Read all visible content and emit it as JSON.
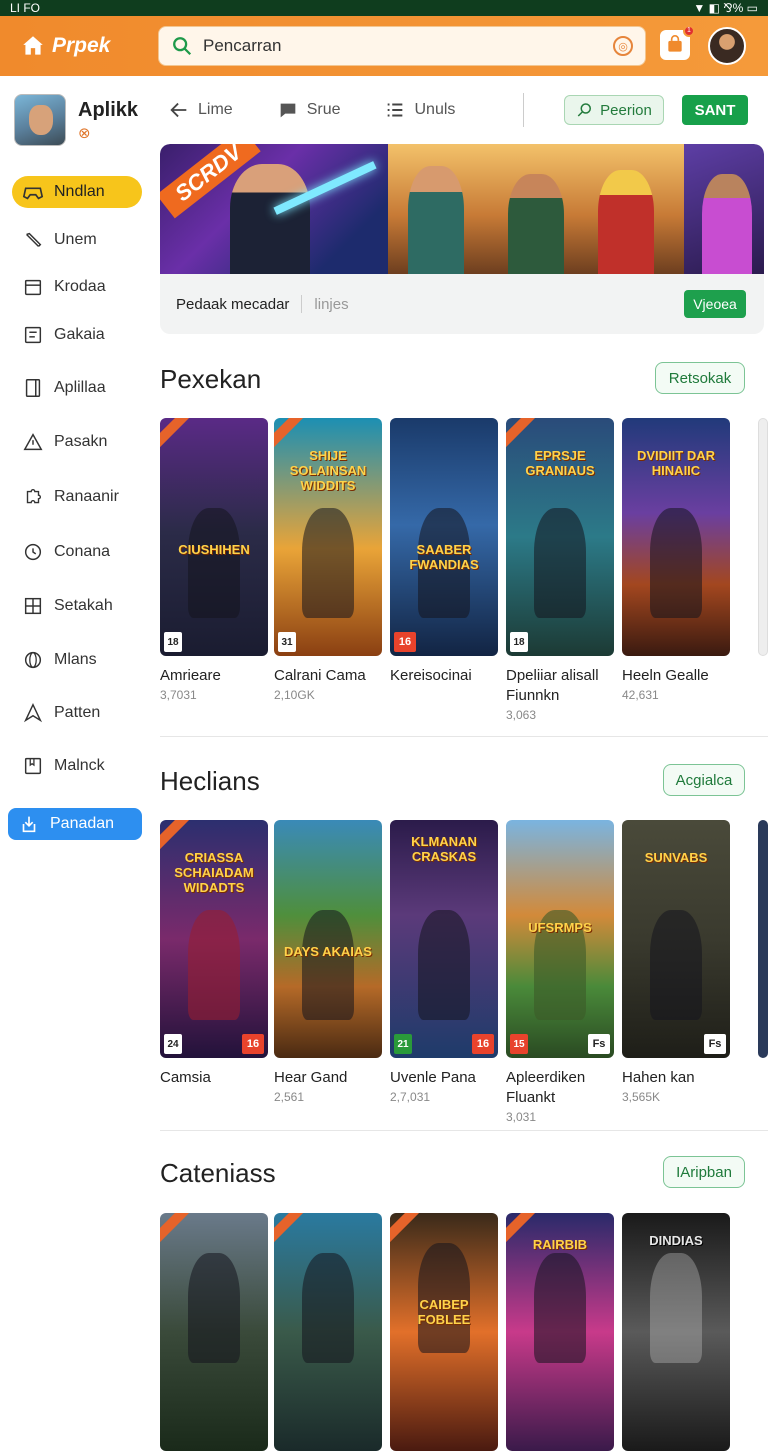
{
  "status": {
    "left": "LI FO",
    "right": "▼ ◧ ⅋% ▭"
  },
  "app": {
    "logo": "Prpek"
  },
  "search": {
    "placeholder": "Pencarran",
    "value": "Pencarran"
  },
  "header": {
    "notification_count": "1"
  },
  "sidebar": {
    "profile_name": "Aplikk",
    "items": [
      {
        "label": "Nndlan",
        "icon": "gamepad-icon"
      },
      {
        "label": "Unem",
        "icon": "pencil-icon"
      },
      {
        "label": "Krodaa",
        "icon": "calendar-icon"
      },
      {
        "label": "Gakaia",
        "icon": "clipboard-icon"
      },
      {
        "label": "Aplillaa",
        "icon": "tablet-icon"
      },
      {
        "label": "Pasakn",
        "icon": "warning-icon"
      },
      {
        "label": "Ranaanir",
        "icon": "puzzle-icon"
      },
      {
        "label": "Conana",
        "icon": "clock-icon"
      },
      {
        "label": "Setakah",
        "icon": "grid-icon"
      },
      {
        "label": "Mlans",
        "icon": "globe-icon"
      },
      {
        "label": "Patten",
        "icon": "location-icon"
      },
      {
        "label": "Malnck",
        "icon": "bookmark-icon"
      },
      {
        "label": "Panadan",
        "icon": "download-icon"
      }
    ]
  },
  "toolbar": {
    "back_label": "Lime",
    "store_label": "Srue",
    "list_label": "Unuls",
    "prec_label": "Peerion",
    "sant_label": "SANT"
  },
  "banner": {
    "tag": "SCRDV",
    "caption": "Pedaak mecadar",
    "sub": "linjes",
    "button": "Vjeoea"
  },
  "sections": [
    {
      "title": "Pexekan",
      "button": "Retsokak",
      "cards": [
        {
          "name": "Amrieare",
          "count": "3,7031",
          "art": "CIUSHIHEN",
          "rating": "18",
          "age": ""
        },
        {
          "name": "Calrani Cama",
          "count": "2,10GK",
          "art": "SHIJE SOLAINSAN WIDDITS",
          "rating": "31",
          "age": ""
        },
        {
          "name": "Kereisocinai",
          "count": "",
          "art": "SAABER FWANDIAS",
          "rating": "",
          "age": "16"
        },
        {
          "name": "Dpeliiar alisall Fiunnkn",
          "count": "3,063",
          "art": "EPRSJE GRANIAUS",
          "rating": "18",
          "age": ""
        },
        {
          "name": "Heeln Gealle",
          "count": "42,631",
          "art": "DVIDIIT DAR HINAIIC",
          "rating": "",
          "age": ""
        }
      ]
    },
    {
      "title": "Heclians",
      "button": "Acgialca",
      "cards": [
        {
          "name": "Camsia",
          "count": "",
          "art": "CRIASSA SCHAIADAM WIDADTS",
          "rating": "24",
          "age": "16"
        },
        {
          "name": "Hear Gand",
          "count": "2,561",
          "art": "DAYS AKAIAS",
          "rating": "",
          "age": ""
        },
        {
          "name": "Uvenle Pana",
          "count": "2,7,031",
          "art": "KLMANAN CRASKAS",
          "rating": "21",
          "age": "16"
        },
        {
          "name": "Apleerdiken Fluankt",
          "count": "3,031",
          "art": "UFSRMPS",
          "rating": "15",
          "age": ""
        },
        {
          "name": "Hahen kan",
          "count": "3,565K",
          "art": "SUNVABS",
          "rating": "",
          "age": ""
        }
      ]
    },
    {
      "title": "Cateniass",
      "button": "IAripban",
      "cards": [
        {
          "name": "",
          "count": "",
          "art": "",
          "rating": "",
          "age": ""
        },
        {
          "name": "",
          "count": "",
          "art": "",
          "rating": "",
          "age": ""
        },
        {
          "name": "",
          "count": "",
          "art": "CAIBEP FOBLEE",
          "rating": "",
          "age": ""
        },
        {
          "name": "",
          "count": "",
          "art": "RAIRBIB",
          "rating": "",
          "age": ""
        },
        {
          "name": "",
          "count": "",
          "art": "DINDIAS",
          "rating": "",
          "age": ""
        }
      ]
    }
  ],
  "colors": {
    "brand_orange": "#f59a3a",
    "accent_green": "#17a04a",
    "active_yellow": "#f7c51b",
    "active_blue": "#2d8ff0"
  }
}
